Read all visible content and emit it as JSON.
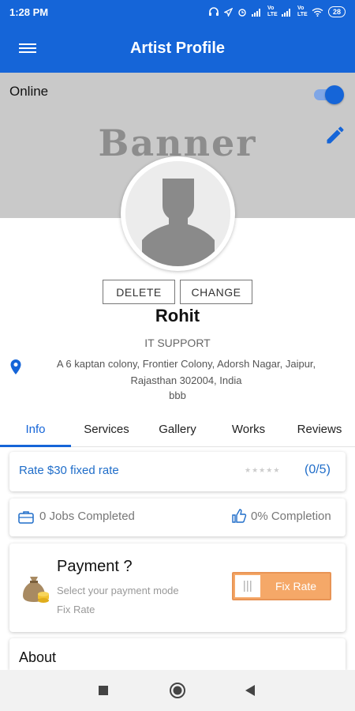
{
  "status_bar": {
    "time": "1:28 PM",
    "signal_labels": [
      "Vo LTE",
      "Vo LTE"
    ],
    "battery": "28"
  },
  "app_bar": {
    "title": "Artist Profile",
    "menu_icon": "hamburger-menu-icon"
  },
  "banner": {
    "online_label": "Online",
    "online_enabled": true,
    "banner_text": "Banner",
    "edit_icon": "pencil-icon"
  },
  "profile": {
    "delete_label": "DELETE",
    "change_label": "CHANGE",
    "name": "Rohit",
    "role": "IT SUPPORT",
    "address_line1": "A 6 kaptan colony, Frontier Colony, Adorsh Nagar, Jaipur,",
    "address_line2": "Rajasthan 302004, India",
    "extra": "bbb"
  },
  "tabs": [
    {
      "label": "Info",
      "active": true
    },
    {
      "label": "Services",
      "active": false
    },
    {
      "label": "Gallery",
      "active": false
    },
    {
      "label": "Works",
      "active": false
    },
    {
      "label": "Reviews",
      "active": false
    }
  ],
  "rate": {
    "text": "Rate $30 fixed rate",
    "stars_filled": 0,
    "stars_total": 5,
    "rating_text": "(0/5)"
  },
  "stats": {
    "jobs_text": "0 Jobs Completed",
    "completion_text": "0% Completion"
  },
  "payment": {
    "title": "Payment ?",
    "subtitle": "Select your payment mode",
    "mode": "Fix Rate",
    "button_label": "Fix Rate"
  },
  "about": {
    "title": "About"
  },
  "colors": {
    "primary": "#1565d8",
    "banner_bg": "#c9c9c9",
    "accent_orange": "#f5a868",
    "link_blue": "#1f6dc9"
  }
}
